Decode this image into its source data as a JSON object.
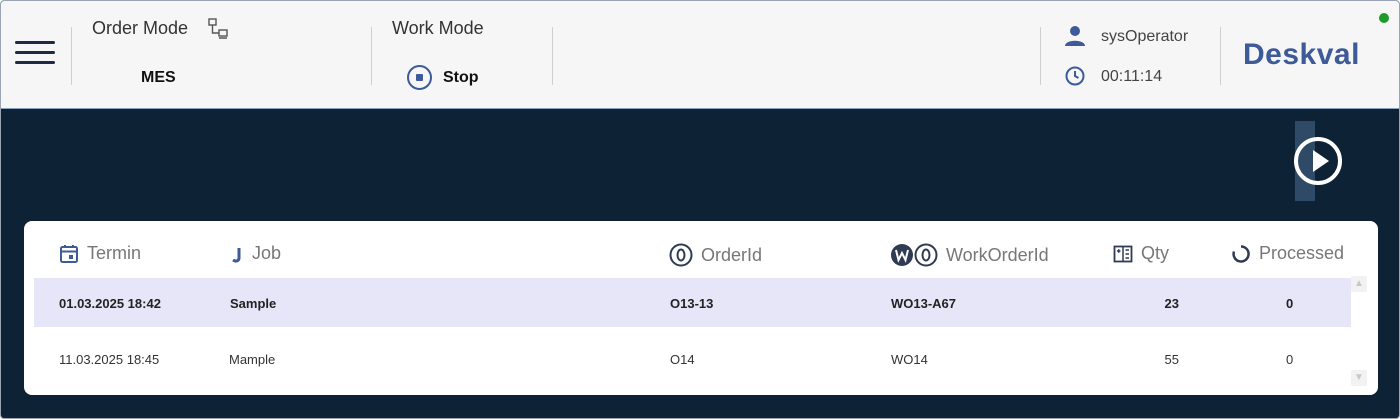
{
  "header": {
    "order_mode_label": "Order Mode",
    "order_mode_value": "MES",
    "work_mode_label": "Work Mode",
    "work_mode_value": "Stop",
    "user": "sysOperator",
    "time": "00:11:14",
    "brand": "Deskval",
    "status_color": "#1e9a2a",
    "accent": "#3d5a99"
  },
  "table": {
    "columns": {
      "termin": "Termin",
      "job": "Job",
      "order_id": "OrderId",
      "work_order_id": "WorkOrderId",
      "qty": "Qty",
      "processed": "Processed"
    },
    "column_icons": {
      "termin": "calendar-icon",
      "job": "job-icon",
      "order_id": "order-id-icon",
      "work_order_id": "work-order-id-icon",
      "qty": "qty-icon",
      "processed": "processed-icon"
    },
    "rows": [
      {
        "termin": "01.03.2025 18:42",
        "job": "Sample",
        "order_id": "O13-13",
        "work_order_id": "WO13-A67",
        "qty": "23",
        "processed": "0",
        "selected": true
      },
      {
        "termin": "11.03.2025 18:45",
        "job": "Mample",
        "order_id": "O14",
        "work_order_id": "WO14",
        "qty": "55",
        "processed": "0",
        "selected": false
      }
    ]
  }
}
